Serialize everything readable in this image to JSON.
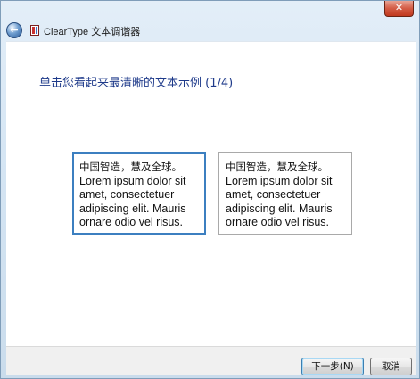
{
  "window": {
    "title": "ClearType 文本调谐器",
    "back_icon": "back-arrow-icon",
    "close_icon": "close-icon",
    "close_glyph": "✕"
  },
  "main": {
    "heading": "单击您看起来最清晰的文本示例 (1/4)",
    "samples": [
      {
        "zh": "中国智造，慧及全球。",
        "text": "Lorem ipsum dolor sit amet, consectetuer adipiscing elit. Mauris ornare odio vel risus."
      },
      {
        "zh": "中国智造，慧及全球。",
        "text": "Lorem ipsum dolor sit amet, consectetuer adipiscing elit. Mauris ornare odio vel risus."
      }
    ]
  },
  "footer": {
    "next_label": "下一步(N)",
    "cancel_label": "取消"
  }
}
